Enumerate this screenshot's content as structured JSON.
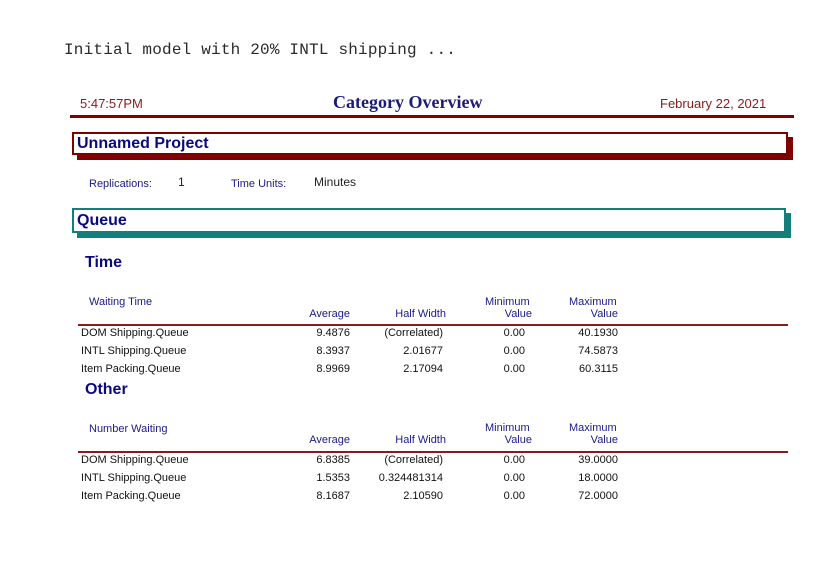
{
  "caption": "Initial model with 20% INTL shipping ...",
  "report": {
    "time": "5:47:57PM",
    "title": "Category Overview",
    "date": "February 22, 2021",
    "colors": {
      "rule": "#800000",
      "section": "#137f7a",
      "heading": "#0a0a80"
    }
  },
  "project": {
    "name": "Unnamed Project",
    "replications_label": "Replications:",
    "replications_value": "1",
    "time_units_label": "Time Units:",
    "time_units_value": "Minutes"
  },
  "section": {
    "title": "Queue",
    "groups": [
      {
        "heading": "Time",
        "stat": "Waiting Time",
        "columns": {
          "average": "Average",
          "half_width": "Half Width",
          "min_1": "Minimum",
          "min_2": "Value",
          "max_1": "Maximum",
          "max_2": "Value"
        },
        "rows": [
          {
            "name": "DOM Shipping.Queue",
            "average": "9.4876",
            "half_width": "(Correlated)",
            "min": "0.00",
            "max": "40.1930"
          },
          {
            "name": "INTL Shipping.Queue",
            "average": "8.3937",
            "half_width": "2.01677",
            "min": "0.00",
            "max": "74.5873"
          },
          {
            "name": "Item Packing.Queue",
            "average": "8.9969",
            "half_width": "2.17094",
            "min": "0.00",
            "max": "60.3115"
          }
        ]
      },
      {
        "heading": "Other",
        "stat": "Number Waiting",
        "columns": {
          "average": "Average",
          "half_width": "Half Width",
          "min_1": "Minimum",
          "min_2": "Value",
          "max_1": "Maximum",
          "max_2": "Value"
        },
        "rows": [
          {
            "name": "DOM Shipping.Queue",
            "average": "6.8385",
            "half_width": "(Correlated)",
            "min": "0.00",
            "max": "39.0000"
          },
          {
            "name": "INTL Shipping.Queue",
            "average": "1.5353",
            "half_width": "0.324481314",
            "min": "0.00",
            "max": "18.0000"
          },
          {
            "name": "Item Packing.Queue",
            "average": "8.1687",
            "half_width": "2.10590",
            "min": "0.00",
            "max": "72.0000"
          }
        ]
      }
    ]
  }
}
